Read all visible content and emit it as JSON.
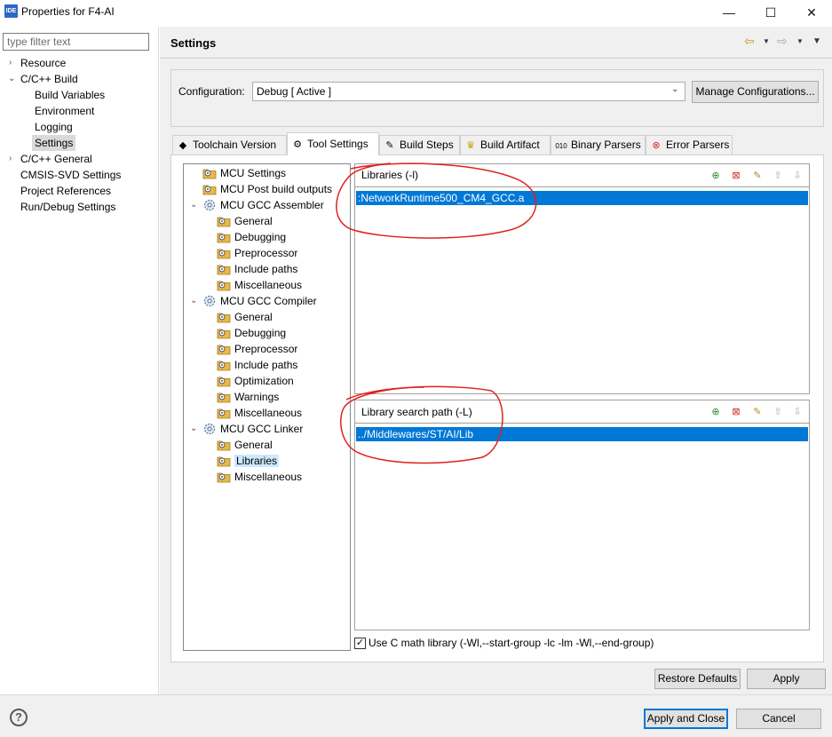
{
  "window": {
    "app_icon": "IDE",
    "title": "Properties for F4-AI",
    "minimize": "—",
    "maximize": "☐",
    "close": "✕"
  },
  "sidebar": {
    "filter_placeholder": "type filter text",
    "items": [
      {
        "label": "Resource",
        "expander": "›"
      },
      {
        "label": "C/C++ Build",
        "expander": "⌄"
      },
      {
        "label": "Build Variables"
      },
      {
        "label": "Environment"
      },
      {
        "label": "Logging"
      },
      {
        "label": "Settings"
      },
      {
        "label": "C/C++ General",
        "expander": "›"
      },
      {
        "label": "CMSIS-SVD Settings"
      },
      {
        "label": "Project References"
      },
      {
        "label": "Run/Debug Settings"
      }
    ]
  },
  "header": {
    "title": "Settings"
  },
  "config": {
    "label": "Configuration:",
    "value": "Debug  [ Active ]",
    "manage_label": "Manage Configurations..."
  },
  "tabs": [
    {
      "label": "Toolchain  Version",
      "icon": "chip-icon"
    },
    {
      "label": "Tool Settings",
      "icon": "tool-settings-icon"
    },
    {
      "label": "Build Steps",
      "icon": "build-steps-icon"
    },
    {
      "label": "Build Artifact",
      "icon": "trophy-icon"
    },
    {
      "label": "Binary Parsers",
      "icon": "binary-icon"
    },
    {
      "label": "Error Parsers",
      "icon": "error-icon"
    }
  ],
  "tool_tree": [
    "MCU Settings",
    "MCU Post build outputs",
    "MCU GCC Assembler",
    "General",
    "Debugging",
    "Preprocessor",
    "Include paths",
    "Miscellaneous",
    "MCU GCC Compiler",
    "General",
    "Debugging",
    "Preprocessor",
    "Include paths",
    "Optimization",
    "Warnings",
    "Miscellaneous",
    "MCU GCC Linker",
    "General",
    "Libraries",
    "Miscellaneous"
  ],
  "libraries": {
    "title": "Libraries (-l)",
    "items": [
      ":NetworkRuntime500_CM4_GCC.a"
    ]
  },
  "library_paths": {
    "title": "Library search path (-L)",
    "items": [
      "../Middlewares/ST/AI/Lib"
    ]
  },
  "cmath": {
    "checked": true,
    "label": "Use C math library (-Wl,--start-group -lc -lm -Wl,--end-group)"
  },
  "buttons": {
    "restore_defaults": "Restore Defaults",
    "apply": "Apply",
    "apply_close": "Apply and Close",
    "cancel": "Cancel"
  },
  "colors": {
    "selection": "#0078d7",
    "annotation": "#e0201c",
    "folder": "#e8b84a"
  }
}
